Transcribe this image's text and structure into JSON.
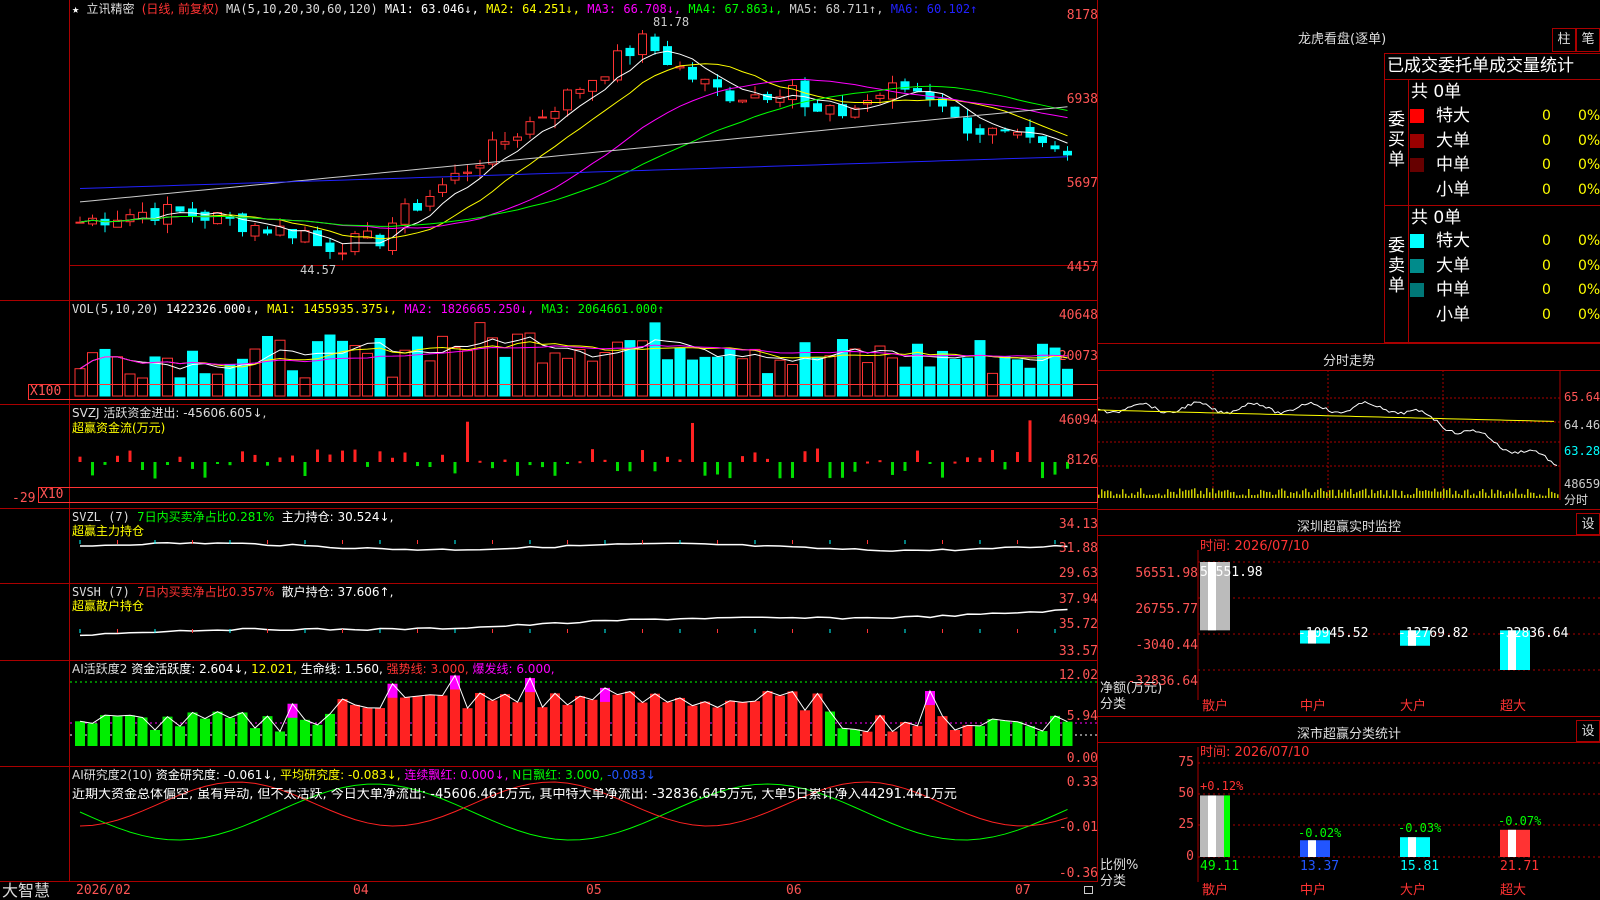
{
  "left": {
    "main": {
      "star": "★",
      "name": "立讯精密",
      "mode": "(日线, 前复权)",
      "ma_param": "MA(5,10,20,30,60,120)",
      "ma1": "MA1: 63.046↓,",
      "ma2": "MA2: 64.251↓,",
      "ma3": "MA3: 66.708↓,",
      "ma4": "MA4: 67.863↓,",
      "ma5": "MA5: 68.711↑,",
      "ma6": "MA6: 60.102↑",
      "y": [
        "8178",
        "6938",
        "5697",
        "4457"
      ],
      "high_label": "81.78",
      "low_label": "44.57"
    },
    "vol": {
      "header": "VOL(5,10,20)",
      "v": "1422326.000↓,",
      "ma1": "MA1: 1455935.375↓,",
      "ma2": "MA2: 1826665.250↓,",
      "ma3": "MA3: 2064661.000↑",
      "y": [
        "40648",
        "20073"
      ],
      "unit": "X100"
    },
    "svzj": {
      "header": "SVZJ  活跃资金进出: -45606.605↓,",
      "sub": "超赢资金流(万元)",
      "y": [
        "46094",
        "8126",
        "-29"
      ],
      "unit": "X10"
    },
    "svzl": {
      "header1": "SVZL (7)",
      "header2": "7日内买卖净占比0.281%",
      "header3": "主力持仓: 30.524↓,",
      "sub": "超赢主力持仓",
      "y": [
        "34.13",
        "31.88",
        "29.63"
      ]
    },
    "svsh": {
      "header1": "SVSH (7)",
      "header2": "7日内买卖净占比0.357%",
      "header3": "散户持仓: 37.606↑,",
      "sub": "超赢散户持仓",
      "y": [
        "37.94",
        "35.72",
        "33.57"
      ]
    },
    "ai1": {
      "h1": "AI活跃度2",
      "h2": "资金活跃度: 2.604↓,",
      "h3": "12.021,",
      "h4": "生命线: 1.560,",
      "h5": "强势线: 3.000,",
      "h6": "爆发线: 6.000,",
      "y": [
        "12.02",
        "5.94",
        "0.00"
      ]
    },
    "ai2": {
      "h1": "AI研究度2(10)",
      "h2": "资金研究度: -0.061↓,",
      "h3": "平均研究度: -0.083↓,",
      "h4": "连续飘红: 0.000↓,",
      "h5": "N日飘红: 3.000,",
      "h6": "-0.083↓",
      "comment": "近期大资金总体偏空, 虽有异动, 但不太活跃, 今日大单净流出: -45606.461万元, 其中特大单净流出: -32836.645万元, 大单5日累计净入44291.441万元",
      "y": [
        "0.33",
        "-0.01",
        "-0.36"
      ]
    },
    "xaxis": {
      "brand": "大智慧",
      "labels": [
        "2026/02",
        "04",
        "05",
        "06",
        "07"
      ]
    }
  },
  "right": {
    "dragon": {
      "title": "龙虎看盘(逐单)",
      "btn1": "柱",
      "btn2": "笔",
      "subtitle": "已成交委托单成交量统计",
      "buy_label": "委买单",
      "sell_label": "委卖单",
      "buy_total": "共 0单",
      "sell_total": "共 0单",
      "buy_rows": [
        {
          "label": "特大",
          "val": "0",
          "pct": "0%",
          "color": "#ff0000"
        },
        {
          "label": "大单",
          "val": "0",
          "pct": "0%",
          "color": "#990000"
        },
        {
          "label": "中单",
          "val": "0",
          "pct": "0%",
          "color": "#660000"
        },
        {
          "label": "小单",
          "val": "0",
          "pct": "0%",
          "color": "#000000"
        }
      ],
      "sell_rows": [
        {
          "label": "特大",
          "val": "0",
          "pct": "0%",
          "color": "#00ffff"
        },
        {
          "label": "大单",
          "val": "0",
          "pct": "0%",
          "color": "#008b8b"
        },
        {
          "label": "中单",
          "val": "0",
          "pct": "0%",
          "color": "#007777"
        },
        {
          "label": "小单",
          "val": "0",
          "pct": "0%",
          "color": "#000000"
        }
      ]
    },
    "intraday": {
      "title": "分时走势",
      "y": [
        "65.64",
        "64.46",
        "63.28"
      ],
      "vol": "48659",
      "corner": "分时"
    },
    "monitor": {
      "title": "深圳超赢实时监控",
      "btn": "设",
      "time": "时间: 2026/07/10",
      "y": [
        "56551.98",
        "26755.77",
        "-3040.44",
        "-32836.64"
      ],
      "ylabel1": "净额(万元)",
      "ylabel2": "分类",
      "categories": [
        "散户",
        "中户",
        "大户",
        "超大"
      ],
      "values": [
        "56551.98",
        "-10945.52",
        "-12769.82",
        "-32836.64"
      ],
      "nums": [
        56551.98,
        -10945.52,
        -12769.82,
        -32836.64
      ]
    },
    "stats": {
      "title": "深市超赢分类统计",
      "btn": "设",
      "time": "时间: 2026/07/10",
      "y": [
        "75",
        "50",
        "25",
        "0"
      ],
      "ylabel1": "比例%",
      "ylabel2": "分类",
      "categories": [
        "散户",
        "中户",
        "大户",
        "超大"
      ],
      "top": [
        "+0.12%",
        "-0.02%",
        "-0.03%",
        "-0.07%"
      ],
      "bottom": [
        "49.11",
        "13.37",
        "15.81",
        "21.71"
      ],
      "nums": [
        49.11,
        13.37,
        15.81,
        21.71
      ]
    }
  }
}
